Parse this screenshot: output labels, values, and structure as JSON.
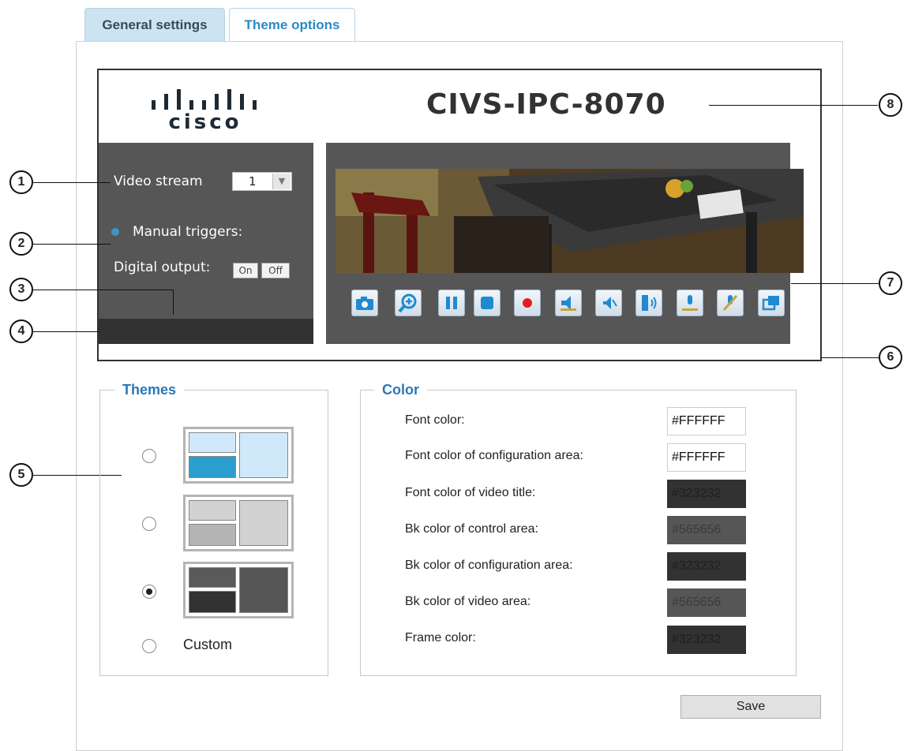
{
  "tabs": [
    {
      "label": "General settings",
      "active": false
    },
    {
      "label": "Theme options",
      "active": true
    }
  ],
  "preview": {
    "logo_text": "cisco",
    "device_title": "CIVS-IPC-8070",
    "video_stream_label": "Video stream",
    "video_stream_value": "1",
    "manual_triggers_label": "Manual triggers:",
    "digital_output_label": "Digital output:",
    "on_label": "On",
    "off_label": "Off",
    "controls": [
      {
        "icon": "camera-icon"
      },
      {
        "icon": "zoom-icon"
      },
      {
        "icon": "pause-icon"
      },
      {
        "icon": "stop-icon"
      },
      {
        "icon": "record-icon"
      },
      {
        "icon": "volume-icon"
      },
      {
        "icon": "mute-icon"
      },
      {
        "icon": "talk-icon"
      },
      {
        "icon": "microphone-icon"
      },
      {
        "icon": "microphone-mute-icon"
      },
      {
        "icon": "fullscreen-icon"
      }
    ]
  },
  "callouts": [
    "1",
    "2",
    "3",
    "4",
    "5",
    "6",
    "7",
    "8"
  ],
  "themes": {
    "legend": "Themes",
    "options": [
      {
        "selected": false,
        "colors": {
          "tl": "#cfe9fb",
          "bl": "#2a9fcf",
          "r": "#cfe9fb"
        }
      },
      {
        "selected": false,
        "colors": {
          "tl": "#d2d2d2",
          "bl": "#b4b4b4",
          "r": "#d2d2d2"
        }
      },
      {
        "selected": true,
        "colors": {
          "tl": "#5a5a5a",
          "bl": "#323232",
          "r": "#565656"
        }
      },
      {
        "selected": false,
        "label": "Custom"
      }
    ]
  },
  "color": {
    "legend": "Color",
    "rows": [
      {
        "label": "Font color:",
        "value": "#FFFFFF",
        "bg": "#FFFFFF",
        "fg": "#111111"
      },
      {
        "label": "Font color of configuration area:",
        "value": "#FFFFFF",
        "bg": "#FFFFFF",
        "fg": "#111111"
      },
      {
        "label": "Font color of video title:",
        "value": "#323232",
        "bg": "#323232",
        "fg": "#1f1f1f"
      },
      {
        "label": "Bk color of control area:",
        "value": "#565656",
        "bg": "#565656",
        "fg": "#3b3b3b"
      },
      {
        "label": "Bk color of configuration area:",
        "value": "#323232",
        "bg": "#323232",
        "fg": "#1f1f1f"
      },
      {
        "label": "Bk color of video area:",
        "value": "#565656",
        "bg": "#565656",
        "fg": "#3b3b3b"
      },
      {
        "label": "Frame color:",
        "value": "#323232",
        "bg": "#323232",
        "fg": "#1f1f1f"
      }
    ]
  },
  "save_label": "Save"
}
